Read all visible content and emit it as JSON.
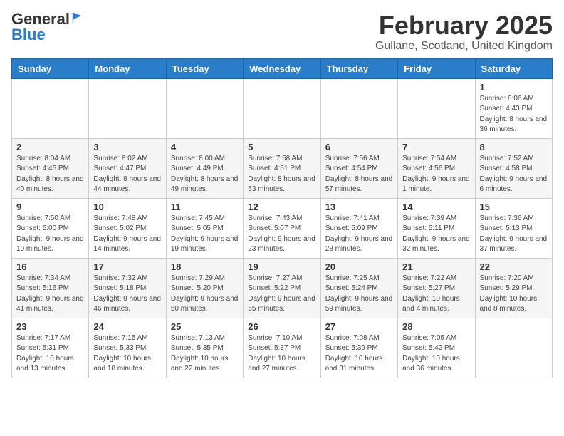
{
  "header": {
    "logo_general": "General",
    "logo_blue": "Blue",
    "title": "February 2025",
    "subtitle": "Gullane, Scotland, United Kingdom"
  },
  "weekdays": [
    "Sunday",
    "Monday",
    "Tuesday",
    "Wednesday",
    "Thursday",
    "Friday",
    "Saturday"
  ],
  "weeks": [
    [
      {
        "day": "",
        "info": ""
      },
      {
        "day": "",
        "info": ""
      },
      {
        "day": "",
        "info": ""
      },
      {
        "day": "",
        "info": ""
      },
      {
        "day": "",
        "info": ""
      },
      {
        "day": "",
        "info": ""
      },
      {
        "day": "1",
        "info": "Sunrise: 8:06 AM\nSunset: 4:43 PM\nDaylight: 8 hours and 36 minutes."
      }
    ],
    [
      {
        "day": "2",
        "info": "Sunrise: 8:04 AM\nSunset: 4:45 PM\nDaylight: 8 hours and 40 minutes."
      },
      {
        "day": "3",
        "info": "Sunrise: 8:02 AM\nSunset: 4:47 PM\nDaylight: 8 hours and 44 minutes."
      },
      {
        "day": "4",
        "info": "Sunrise: 8:00 AM\nSunset: 4:49 PM\nDaylight: 8 hours and 49 minutes."
      },
      {
        "day": "5",
        "info": "Sunrise: 7:58 AM\nSunset: 4:51 PM\nDaylight: 8 hours and 53 minutes."
      },
      {
        "day": "6",
        "info": "Sunrise: 7:56 AM\nSunset: 4:54 PM\nDaylight: 8 hours and 57 minutes."
      },
      {
        "day": "7",
        "info": "Sunrise: 7:54 AM\nSunset: 4:56 PM\nDaylight: 9 hours and 1 minute."
      },
      {
        "day": "8",
        "info": "Sunrise: 7:52 AM\nSunset: 4:58 PM\nDaylight: 9 hours and 6 minutes."
      }
    ],
    [
      {
        "day": "9",
        "info": "Sunrise: 7:50 AM\nSunset: 5:00 PM\nDaylight: 9 hours and 10 minutes."
      },
      {
        "day": "10",
        "info": "Sunrise: 7:48 AM\nSunset: 5:02 PM\nDaylight: 9 hours and 14 minutes."
      },
      {
        "day": "11",
        "info": "Sunrise: 7:45 AM\nSunset: 5:05 PM\nDaylight: 9 hours and 19 minutes."
      },
      {
        "day": "12",
        "info": "Sunrise: 7:43 AM\nSunset: 5:07 PM\nDaylight: 9 hours and 23 minutes."
      },
      {
        "day": "13",
        "info": "Sunrise: 7:41 AM\nSunset: 5:09 PM\nDaylight: 9 hours and 28 minutes."
      },
      {
        "day": "14",
        "info": "Sunrise: 7:39 AM\nSunset: 5:11 PM\nDaylight: 9 hours and 32 minutes."
      },
      {
        "day": "15",
        "info": "Sunrise: 7:36 AM\nSunset: 5:13 PM\nDaylight: 9 hours and 37 minutes."
      }
    ],
    [
      {
        "day": "16",
        "info": "Sunrise: 7:34 AM\nSunset: 5:16 PM\nDaylight: 9 hours and 41 minutes."
      },
      {
        "day": "17",
        "info": "Sunrise: 7:32 AM\nSunset: 5:18 PM\nDaylight: 9 hours and 46 minutes."
      },
      {
        "day": "18",
        "info": "Sunrise: 7:29 AM\nSunset: 5:20 PM\nDaylight: 9 hours and 50 minutes."
      },
      {
        "day": "19",
        "info": "Sunrise: 7:27 AM\nSunset: 5:22 PM\nDaylight: 9 hours and 55 minutes."
      },
      {
        "day": "20",
        "info": "Sunrise: 7:25 AM\nSunset: 5:24 PM\nDaylight: 9 hours and 59 minutes."
      },
      {
        "day": "21",
        "info": "Sunrise: 7:22 AM\nSunset: 5:27 PM\nDaylight: 10 hours and 4 minutes."
      },
      {
        "day": "22",
        "info": "Sunrise: 7:20 AM\nSunset: 5:29 PM\nDaylight: 10 hours and 8 minutes."
      }
    ],
    [
      {
        "day": "23",
        "info": "Sunrise: 7:17 AM\nSunset: 5:31 PM\nDaylight: 10 hours and 13 minutes."
      },
      {
        "day": "24",
        "info": "Sunrise: 7:15 AM\nSunset: 5:33 PM\nDaylight: 10 hours and 18 minutes."
      },
      {
        "day": "25",
        "info": "Sunrise: 7:13 AM\nSunset: 5:35 PM\nDaylight: 10 hours and 22 minutes."
      },
      {
        "day": "26",
        "info": "Sunrise: 7:10 AM\nSunset: 5:37 PM\nDaylight: 10 hours and 27 minutes."
      },
      {
        "day": "27",
        "info": "Sunrise: 7:08 AM\nSunset: 5:39 PM\nDaylight: 10 hours and 31 minutes."
      },
      {
        "day": "28",
        "info": "Sunrise: 7:05 AM\nSunset: 5:42 PM\nDaylight: 10 hours and 36 minutes."
      },
      {
        "day": "",
        "info": ""
      }
    ]
  ]
}
